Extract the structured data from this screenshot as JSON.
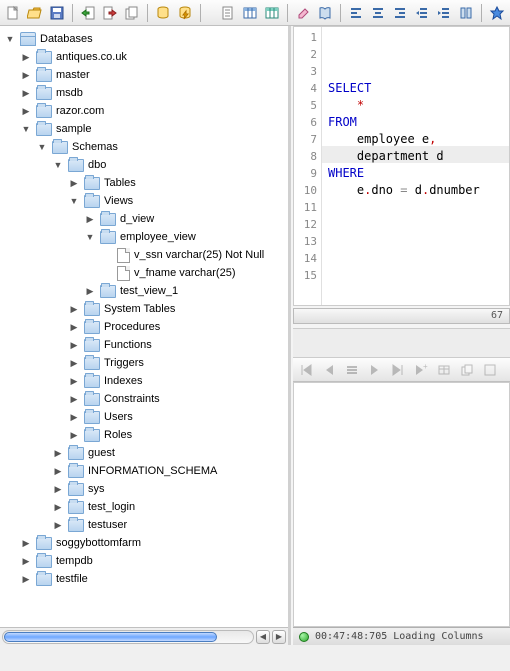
{
  "toolbar": {
    "row1": [
      "new-file",
      "open-folder",
      "save",
      "sep",
      "import-green",
      "export-red",
      "copy-stack",
      "sep",
      "db-cylinder",
      "db-lightning",
      "sep"
    ],
    "row1b": [
      "doc-doc",
      "table-blue",
      "table-teal",
      "sep",
      "eraser",
      "book",
      "sep",
      "align-left",
      "align-center",
      "align-right",
      "indent-less",
      "indent-more",
      "columns",
      "sep",
      "star-blue"
    ]
  },
  "tree": {
    "root": {
      "label": "Databases",
      "icon": "db",
      "expand": "open",
      "depth": 0
    },
    "items": [
      {
        "label": "antiques.co.uk",
        "icon": "folder",
        "expand": "closed",
        "depth": 1
      },
      {
        "label": "master",
        "icon": "folder",
        "expand": "closed",
        "depth": 1
      },
      {
        "label": "msdb",
        "icon": "folder",
        "expand": "closed",
        "depth": 1
      },
      {
        "label": "razor.com",
        "icon": "folder",
        "expand": "closed",
        "depth": 1
      },
      {
        "label": "sample",
        "icon": "folder",
        "expand": "open",
        "depth": 1
      },
      {
        "label": "Schemas",
        "icon": "folder",
        "expand": "open",
        "depth": 2
      },
      {
        "label": "dbo",
        "icon": "folder",
        "expand": "open",
        "depth": 3
      },
      {
        "label": "Tables",
        "icon": "folder",
        "expand": "closed",
        "depth": 4
      },
      {
        "label": "Views",
        "icon": "folder",
        "expand": "open",
        "depth": 4
      },
      {
        "label": "d_view",
        "icon": "folder",
        "expand": "closed",
        "depth": 5
      },
      {
        "label": "employee_view",
        "icon": "folder",
        "expand": "open",
        "depth": 5
      },
      {
        "label": "v_ssn varchar(25) Not Null",
        "icon": "file",
        "expand": "none",
        "depth": 6
      },
      {
        "label": "v_fname varchar(25)",
        "icon": "file",
        "expand": "none",
        "depth": 6
      },
      {
        "label": "test_view_1",
        "icon": "folder",
        "expand": "closed",
        "depth": 5
      },
      {
        "label": "System Tables",
        "icon": "folder",
        "expand": "closed",
        "depth": 4
      },
      {
        "label": "Procedures",
        "icon": "folder",
        "expand": "closed",
        "depth": 4
      },
      {
        "label": "Functions",
        "icon": "folder",
        "expand": "closed",
        "depth": 4
      },
      {
        "label": "Triggers",
        "icon": "folder",
        "expand": "closed",
        "depth": 4
      },
      {
        "label": "Indexes",
        "icon": "folder",
        "expand": "closed",
        "depth": 4
      },
      {
        "label": "Constraints",
        "icon": "folder",
        "expand": "closed",
        "depth": 4
      },
      {
        "label": "Users",
        "icon": "folder",
        "expand": "closed",
        "depth": 4
      },
      {
        "label": "Roles",
        "icon": "folder",
        "expand": "closed",
        "depth": 4
      },
      {
        "label": "guest",
        "icon": "folder",
        "expand": "closed",
        "depth": 3
      },
      {
        "label": "INFORMATION_SCHEMA",
        "icon": "folder",
        "expand": "closed",
        "depth": 3
      },
      {
        "label": "sys",
        "icon": "folder",
        "expand": "closed",
        "depth": 3
      },
      {
        "label": "test_login",
        "icon": "folder",
        "expand": "closed",
        "depth": 3
      },
      {
        "label": "testuser",
        "icon": "folder",
        "expand": "closed",
        "depth": 3
      },
      {
        "label": "soggybottomfarm",
        "icon": "folder",
        "expand": "closed",
        "depth": 1
      },
      {
        "label": "tempdb",
        "icon": "folder",
        "expand": "closed",
        "depth": 1
      },
      {
        "label": "testfile",
        "icon": "folder",
        "expand": "closed",
        "depth": 1
      }
    ]
  },
  "editor": {
    "line_count": 15,
    "tokens": [
      [
        {
          "t": "SELECT",
          "c": "blue"
        }
      ],
      [
        {
          "t": "    ",
          "c": "black"
        },
        {
          "t": "*",
          "c": "red"
        }
      ],
      [
        {
          "t": "FROM",
          "c": "blue"
        }
      ],
      [
        {
          "t": "    employee e",
          "c": "black"
        },
        {
          "t": ",",
          "c": "red"
        }
      ],
      [
        {
          "t": "    department d",
          "c": "black"
        }
      ],
      [
        {
          "t": "WHERE",
          "c": "blue"
        }
      ],
      [
        {
          "t": "    e",
          "c": "black"
        },
        {
          "t": ".",
          "c": "red"
        },
        {
          "t": "dno ",
          "c": "black"
        },
        {
          "t": "=",
          "c": "gray"
        },
        {
          "t": " d",
          "c": "black"
        },
        {
          "t": ".",
          "c": "red"
        },
        {
          "t": "dnumber",
          "c": "black"
        }
      ],
      [],
      [],
      [],
      [],
      [],
      [],
      [],
      []
    ],
    "status_right": "67"
  },
  "results_toolbar": [
    "rs-first",
    "rs-prev",
    "rs-rows",
    "rs-next",
    "rs-last",
    "rs-add",
    "rs-table",
    "rs-copy",
    "rs-export"
  ],
  "statusbar": {
    "text": "00:47:48:705 Loading Columns"
  }
}
